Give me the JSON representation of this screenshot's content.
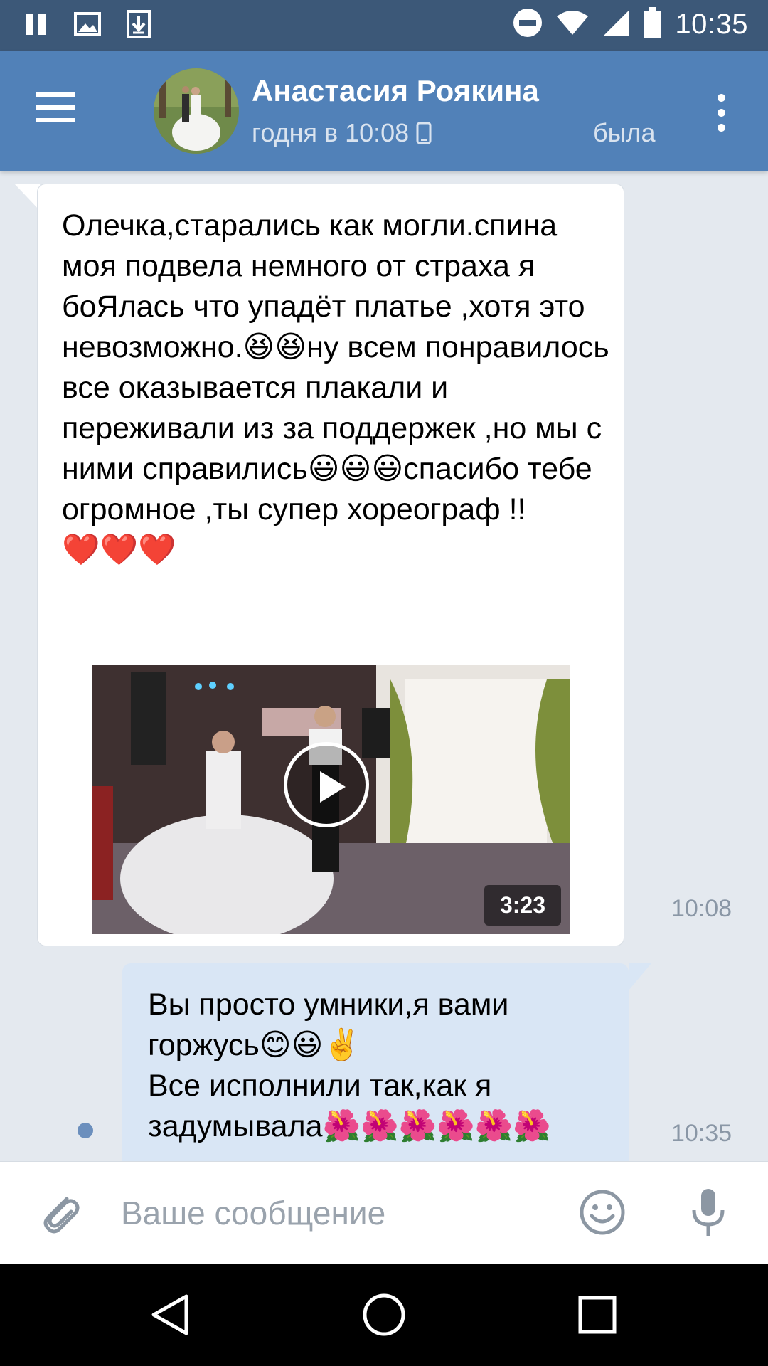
{
  "status_bar": {
    "time": "10:35",
    "left_icons": [
      "pause-icon",
      "image-icon",
      "download-icon"
    ],
    "right_icons": [
      "do-not-disturb-icon",
      "wifi-icon",
      "signal-icon",
      "battery-icon"
    ]
  },
  "header": {
    "name": "Анастасия Роякина",
    "status_a": "годня в 10:08",
    "status_b": "была",
    "status_device_icon": "phone-icon",
    "colors": {
      "bar": "#5181b8",
      "status_bar": "#3c5878"
    }
  },
  "messages": [
    {
      "direction": "incoming",
      "text": "Олечка,старались как могли.спина моя подвела немного от страха я боЯлась что упадёт платье ,хотя это невозможно.😆😆ну всем понравилось все оказывается плакали и переживали из за поддержек ,но мы с ними справились😃😃😃спасибо тебе огромное ,ты супер хореограф !!\n❤️❤️❤️",
      "video": {
        "duration": "3:23"
      },
      "time": "10:08"
    },
    {
      "direction": "outgoing",
      "text": "Вы просто умники,я вами горжусь😊😃✌️\nВсе исполнили так,как я задумывала🌺🌺🌺🌺🌺🌺",
      "time": "10:35",
      "unread": true
    }
  ],
  "composer": {
    "placeholder": "Ваше сообщение",
    "icons": [
      "paperclip-icon",
      "smile-icon",
      "microphone-icon"
    ]
  },
  "nav": [
    "back-icon",
    "home-icon",
    "recents-icon"
  ]
}
